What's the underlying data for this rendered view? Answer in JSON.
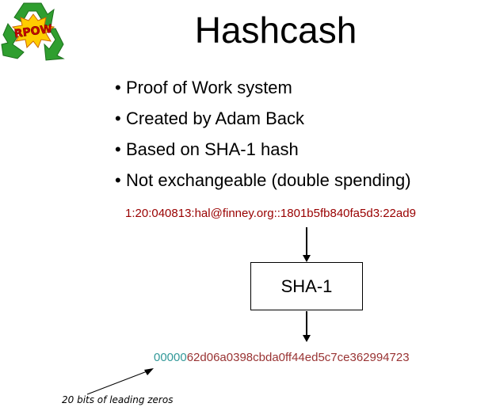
{
  "logo": {
    "text": "RPOW",
    "symbol": "recycle-symbol",
    "colors": {
      "arrows": "#33aa33",
      "burst": "#ffcc00",
      "text": "#cc0000"
    }
  },
  "title": "Hashcash",
  "bullets": [
    "Proof of Work system",
    "Created by Adam Back",
    "Based on SHA-1 hash",
    "Not exchangeable (double spending)"
  ],
  "stamp": "1:20:040813:hal@finney.org::1801b5fb840fa5d3:22ad9",
  "box_label": "SHA-1",
  "hash": {
    "zeros": "00000",
    "rest": "62d06a0398cbda0ff44ed5c7ce362994723"
  },
  "note": "20 bits of leading zeros",
  "colors": {
    "stamp": "#990000",
    "hash_zeros": "#339999",
    "hash_rest": "#993333"
  }
}
